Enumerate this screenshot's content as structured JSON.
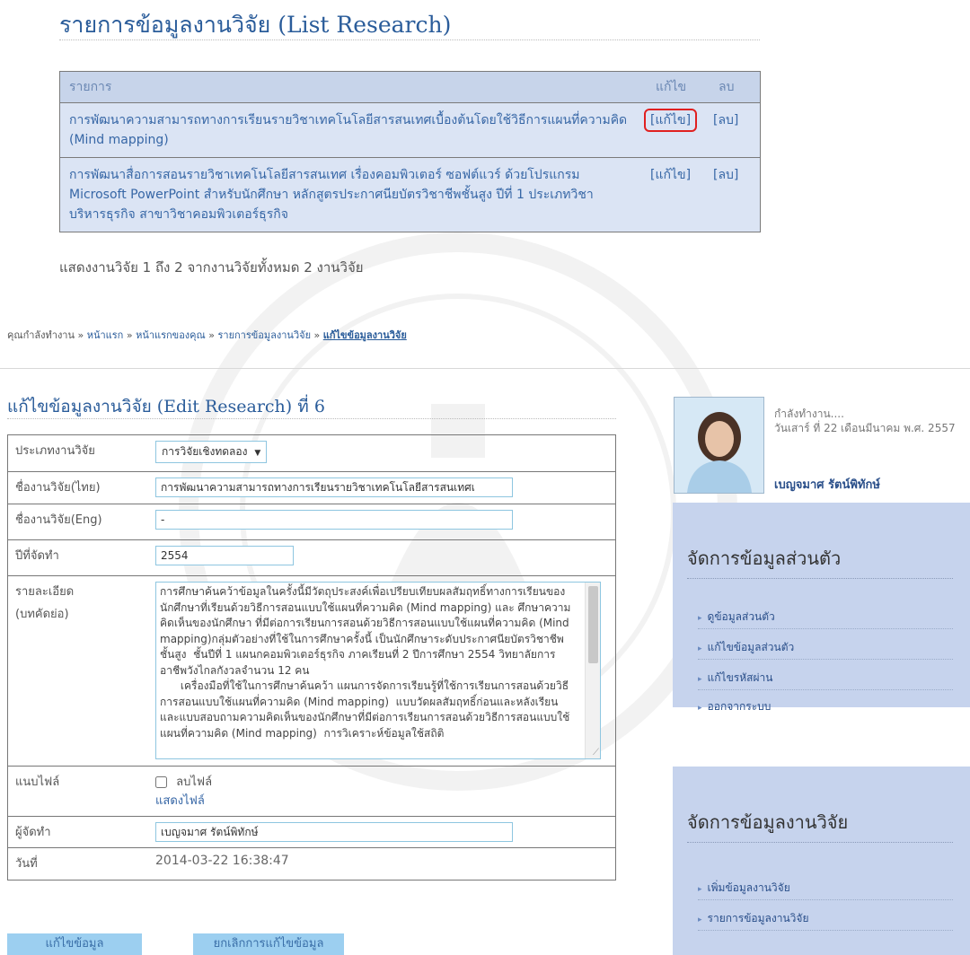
{
  "list": {
    "title": "รายการข้อมูลงานวิจัย (List Research)",
    "headers": {
      "item": "รายการ",
      "edit": "แก้ไข",
      "delete": "ลบ"
    },
    "rows": [
      {
        "title": "การพัฒนาความสามารถทางการเรียนรายวิชาเทคโนโลยีสารสนเทศเบื้องต้นโดยใช้วิธีการแผนที่ความคิด (Mind mapping)",
        "edit": "[แก้ไข]",
        "delete": "[ลบ]"
      },
      {
        "title": "การพัฒนาสื่อการสอนรายวิชาเทคโนโลยีสารสนเทศ เรื่องคอมพิวเตอร์ ซอฟต์แวร์ ด้วยโปรแกรม Microsoft PowerPoint สำหรับนักศึกษา หลักสูตรประกาศนียบัตรวิชาชีพชั้นสูง ปีที่ 1 ประเภทวิชาบริหารธุรกิจ สาขาวิชาคอมพิวเตอร์ธุรกิจ",
        "edit": "[แก้ไข]",
        "delete": "[ลบ]"
      }
    ],
    "summary": "แสดงงานวิจัย 1 ถึง 2 จากงานวิจัยทั้งหมด 2 งานวิจัย"
  },
  "breadcrumb": {
    "prefix": "คุณกำลังทำงาน »",
    "items": [
      "หน้าแรก",
      "หน้าแรกของคุณ",
      "รายการข้อมูลงานวิจัย",
      "แก้ไขข้อมูลงานวิจัย"
    ],
    "separator": "»"
  },
  "edit": {
    "title_main": "แก้ไขข้อมูลงานวิจัย (Edit Research) ที่",
    "title_number": "6",
    "fields": {
      "type": {
        "label": "ประเภทงานวิจัย",
        "value": "การวิจัยเชิงทดลอง"
      },
      "name_th": {
        "label": "ชื่องานวิจัย(ไทย)",
        "value": "การพัฒนาความสามารถทางการเรียนรายวิชาเทคโนโลยีสารสนเทศเ"
      },
      "name_en": {
        "label": "ชื่องานวิจัย(Eng)",
        "value": "-"
      },
      "year": {
        "label": "ปีที่จัดทำ",
        "value": "2554"
      },
      "detail": {
        "label_line1": "รายละเอียด",
        "label_line2": "(บทคัดย่อ)",
        "value": "การศึกษาค้นคว้าข้อมูลในครั้งนี้มีวัตถุประสงค์เพื่อเปรียบเทียบผลสัมฤทธิ์ทางการเรียนของนักศึกษาที่เรียนด้วยวิธีการสอนแบบใช้แผนที่ความคิด (Mind mapping) และ ศึกษาความคิดเห็นของนักศึกษา ที่มีต่อการเรียนการสอนด้วยวิธีการสอนแบบใช้แผนที่ความคิด (Mind mapping)กลุ่มตัวอย่างที่ใช้ในการศึกษาครั้งนี้ เป็นนักศึกษาระดับประกาศนียบัตรวิชาชีพชั้นสูง  ชั้นปีที่ 1 แผนกคอมพิวเตอร์ธุรกิจ ภาคเรียนที่ 2 ปีการศึกษา 2554 วิทยาลัยการอาชีพวังไกลกังวลจำนวน 12 คน\n      เครื่องมือที่ใช้ในการศึกษาค้นคว้า แผนการจัดการเรียนรู้ที่ใช้การเรียนการสอนด้วยวิธีการสอนแบบใช้แผนที่ความคิด (Mind mapping)  แบบวัดผลสัมฤทธิ์ก่อนและหลังเรียน   และแบบสอบถามความคิดเห็นของนักศึกษาที่มีต่อการเรียนการสอนด้วยวิธีการสอนแบบใช้แผนที่ความคิด (Mind mapping)  การวิเคราะห์ข้อมูลใช้สถิติ"
      },
      "attach": {
        "label": "แนบไฟล์",
        "checkbox_label": "ลบไฟล์",
        "link": "แสดงไฟล์"
      },
      "author": {
        "label": "ผู้จัดทำ",
        "value": "เบญจมาศ รัตน์พิทักษ์"
      },
      "date": {
        "label": "วันที่",
        "value": "2014-03-22 16:38:47"
      }
    },
    "buttons": {
      "save": "แก้ไขข้อมูล",
      "cancel": "ยกเลิกการแก้ไขข้อมูล"
    }
  },
  "profile": {
    "status": "กำลังทำงาน....",
    "date": "วันเสาร์ ที่ 22 เดือนมีนาคม พ.ศ. 2557",
    "name": "เบญจมาศ รัตน์พิทักษ์"
  },
  "personal_menu": {
    "heading": "จัดการข้อมูลส่วนตัว",
    "items": [
      "ดูข้อมูลส่วนตัว",
      "แก้ไขข้อมูลส่วนตัว",
      "แก้ไขรหัสผ่าน",
      "ออกจากระบบ"
    ]
  },
  "research_menu": {
    "heading": "จัดการข้อมูลงานวิจัย",
    "items": [
      "เพิ่มข้อมูลงานวิจัย",
      "รายการข้อมูลงานวิจัย"
    ]
  },
  "colors": {
    "link": "#3767a6",
    "table_header": "#c7d4ea",
    "table_row": "#dbe4f4",
    "sidebar": "#c6d3ed",
    "button": "#9ccff0",
    "highlight": "#e02020"
  }
}
